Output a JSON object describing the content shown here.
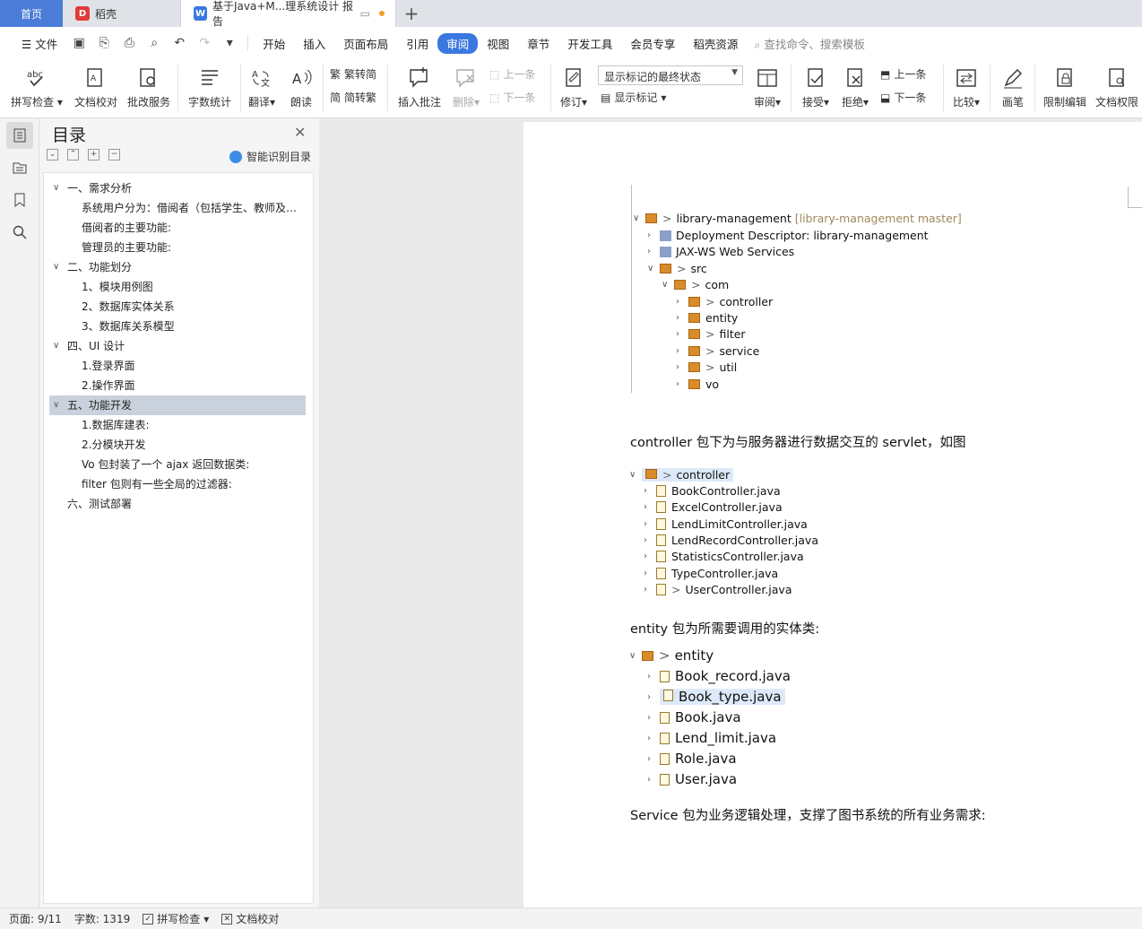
{
  "tabs": {
    "home": "首页",
    "docer": "稻壳",
    "doc": "基于Java+M...理系统设计 报告",
    "plus": "+"
  },
  "menu": {
    "file": "文件",
    "items": [
      "开始",
      "插入",
      "页面布局",
      "引用",
      "审阅",
      "视图",
      "章节",
      "开发工具",
      "会员专享",
      "稻壳资源"
    ],
    "search": "查找命令、搜索模板"
  },
  "ribbon": {
    "spell": "拼写检查",
    "proof": "文档校对",
    "revise_service": "批改服务",
    "word_count": "字数统计",
    "translate": "翻译",
    "read_aloud": "朗读",
    "trad_to_simp": "繁转简",
    "simp_to_trad": "简转繁",
    "insert_comment": "插入批注",
    "delete": "删除",
    "prev": "上一条",
    "next": "下一条",
    "track": "修订",
    "display_mode": "显示标记的最终状态",
    "show_markup": "显示标记",
    "review": "审阅",
    "accept": "接受",
    "reject": "拒绝",
    "prev2": "上一条",
    "next2": "下一条",
    "compare": "比较",
    "pen": "画笔",
    "restrict": "限制编辑",
    "permission": "文档权限"
  },
  "toc": {
    "title": "目录",
    "smart": "智能识别目录",
    "items": [
      "一、需求分析",
      "系统用户分为：借阅者（包括学生、教师及…",
      "借阅者的主要功能:",
      "管理员的主要功能:",
      "二、功能划分",
      "1、模块用例图",
      "2、数据库实体关系",
      "3、数据库关系模型",
      "四、UI 设计",
      "1.登录界面",
      "2.操作界面",
      "五、功能开发",
      "1.数据库建表:",
      "2.分模块开发",
      "Vo 包封装了一个 ajax 返回数据类:",
      "filter 包则有一些全局的过滤器:",
      "六、测试部署"
    ]
  },
  "tree1": {
    "root": "library-management",
    "root_ann": "[library-management master]",
    "dd": "Deployment Descriptor: library-management",
    "jaxws": "JAX-WS Web Services",
    "src": "src",
    "com": "com",
    "controller": "controller",
    "entity": "entity",
    "filter": "filter",
    "service": "service",
    "util": "util",
    "vo": "vo"
  },
  "para1": "controller 包下为与服务器进行数据交互的 servlet，如图",
  "tree2": {
    "root": "controller",
    "files": [
      "BookController.java",
      "ExcelController.java",
      "LendLimitController.java",
      "LendRecordController.java",
      "StatisticsController.java",
      "TypeController.java",
      "UserController.java"
    ]
  },
  "para2": "entity 包为所需要调用的实体类:",
  "tree3": {
    "root": "entity",
    "files": [
      "Book_record.java",
      "Book_type.java",
      "Book.java",
      "Lend_limit.java",
      "Role.java",
      "User.java"
    ]
  },
  "para3": "Service 包为业务逻辑处理，支撑了图书系统的所有业务需求:",
  "status": {
    "page": "页面: 9/11",
    "words": "字数: 1319",
    "spell": "拼写检查",
    "proof": "文档校对"
  }
}
